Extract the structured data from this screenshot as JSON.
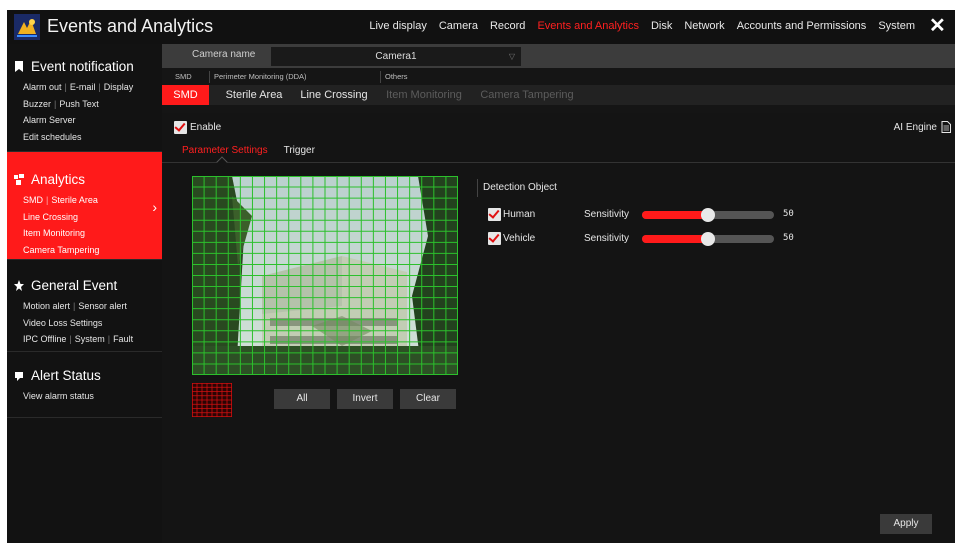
{
  "app": {
    "title": "Events and Analytics",
    "logo_icon": "app-logo-icon",
    "close_icon": "close-icon"
  },
  "topnav": [
    "Live display",
    "Camera",
    "Record",
    "Events and Analytics",
    "Disk",
    "Network",
    "Accounts and Permissions",
    "System"
  ],
  "topnav_active": "Events and Analytics",
  "sidebar": {
    "groups": [
      {
        "title": "Event notification",
        "icon": "bookmark-icon",
        "rows": [
          [
            "Alarm out",
            "E-mail",
            "Display"
          ],
          [
            "Buzzer",
            "Push Text"
          ],
          [
            "Alarm Server"
          ],
          [
            "Edit schedules"
          ]
        ]
      },
      {
        "title": "Analytics",
        "icon": "analytics-icon",
        "active": true,
        "rows": [
          [
            "SMD",
            "Sterile Area"
          ],
          [
            "Line Crossing"
          ],
          [
            "Item Monitoring"
          ],
          [
            "Camera Tampering"
          ]
        ]
      },
      {
        "title": "General Event",
        "icon": "event-icon",
        "rows": [
          [
            "Motion alert",
            "Sensor alert"
          ],
          [
            "Video Loss Settings"
          ],
          [
            "IPC Offline",
            "System",
            "Fault"
          ]
        ]
      },
      {
        "title": "Alert Status",
        "icon": "alert-status-icon",
        "rows": [
          [
            "View alarm status"
          ]
        ]
      }
    ],
    "expand_icon": "chevron-right-icon"
  },
  "camera": {
    "label": "Camera name",
    "value": "Camera1"
  },
  "tab_groups": {
    "smd_caption": "SMD",
    "perimeter_caption": "Perimeter Monitoring (DDA)",
    "others_caption": "Others",
    "tabs": {
      "smd": "SMD",
      "sterile": "Sterile Area",
      "line": "Line Crossing",
      "item": "Item Monitoring",
      "tamper": "Camera Tampering"
    }
  },
  "enable_label": "Enable",
  "ai_engine_label": "AI Engine",
  "subtabs": {
    "params": "Parameter Settings",
    "trigger": "Trigger"
  },
  "buttons": {
    "all": "All",
    "invert": "Invert",
    "clear": "Clear",
    "apply": "Apply"
  },
  "detection": {
    "title": "Detection Object",
    "items": [
      {
        "name": "Human",
        "checked": true,
        "sensitivity_label": "Sensitivity",
        "sensitivity": 50
      },
      {
        "name": "Vehicle",
        "checked": true,
        "sensitivity_label": "Sensitivity",
        "sensitivity": 50
      }
    ]
  },
  "colors": {
    "accent": "#ff1a1a",
    "grid": "#2cc02c",
    "thumb_grid": "#d01010"
  }
}
